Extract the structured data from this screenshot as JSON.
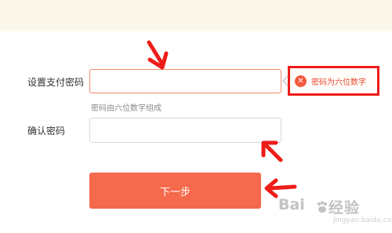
{
  "form": {
    "pay_password_label": "设置支付密码",
    "pay_password_value": "",
    "password_hint": "密码由六位数字组成",
    "confirm_password_label": "确认密码",
    "confirm_password_value": "",
    "next_button": "下一步"
  },
  "error_tip": {
    "icon": "close-icon",
    "text": "密码为六位数字",
    "border_color": "#ee1c18"
  },
  "annotations": {
    "arrow_color": "#ee1c18"
  },
  "colors": {
    "top_band": "#fbf7ea",
    "button": "#f5694c",
    "error_input_border": "#f08a6c"
  },
  "watermark": {
    "brand_left": "Bai",
    "brand_right": "经验",
    "url": "jingyan.baidu.com"
  }
}
